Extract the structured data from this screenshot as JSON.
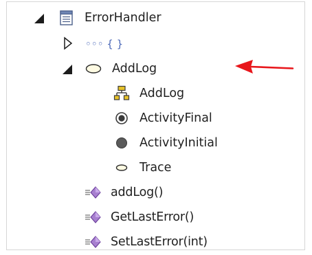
{
  "tree": {
    "class_node": {
      "label": "ErrorHandler",
      "icon": "class-icon",
      "expanded": true
    },
    "attributes_node": {
      "label": "◦◦◦ { }",
      "icon": "attributes-icon",
      "expanded": false
    },
    "activity_node": {
      "label": "AddLog",
      "icon": "activity-icon",
      "expanded": true,
      "children": [
        {
          "label": "AddLog",
          "icon": "activity-diagram-icon"
        },
        {
          "label": "ActivityFinal",
          "icon": "activity-final-icon"
        },
        {
          "label": "ActivityInitial",
          "icon": "activity-initial-icon"
        },
        {
          "label": "Trace",
          "icon": "action-icon"
        }
      ]
    },
    "operations": [
      {
        "label": "addLog()",
        "icon": "operation-icon"
      },
      {
        "label": "GetLastError()",
        "icon": "operation-icon"
      },
      {
        "label": "SetLastError(int)",
        "icon": "operation-icon"
      }
    ]
  },
  "annotation": {
    "color": "#e8161b",
    "icon": "arrow-left-icon"
  }
}
